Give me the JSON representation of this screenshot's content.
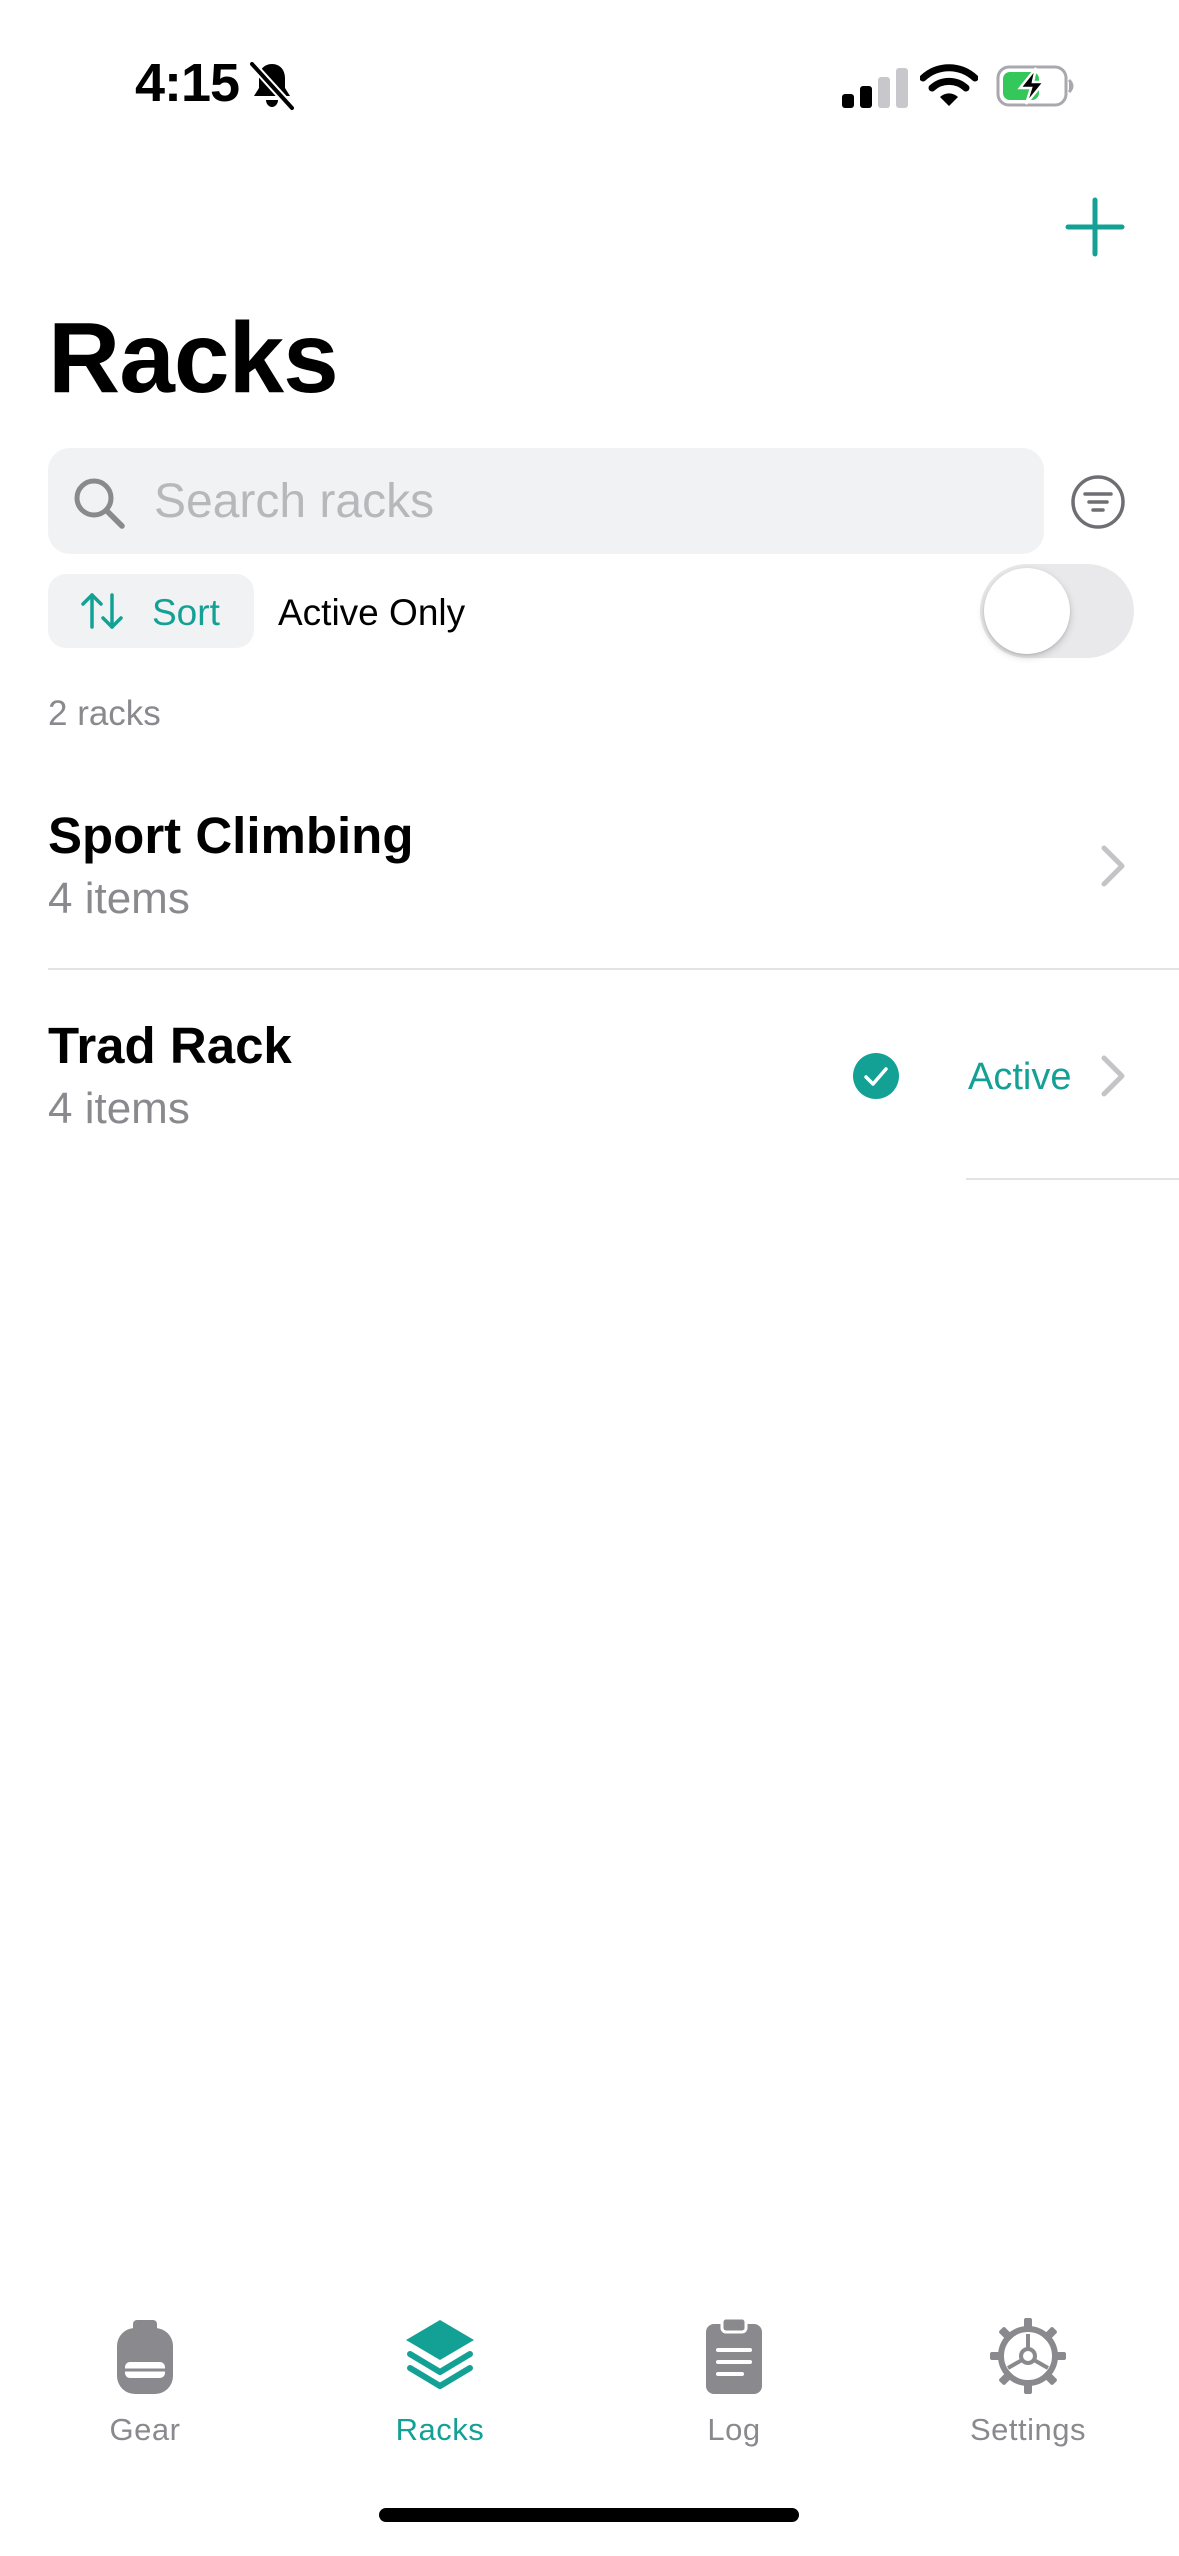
{
  "status_bar": {
    "time": "4:15",
    "silent_icon": "bell-slash-icon",
    "signal_icon": "cellular-signal-icon",
    "wifi_icon": "wifi-icon",
    "battery_icon": "battery-charging-icon"
  },
  "header": {
    "title": "Racks",
    "add_icon": "plus-icon"
  },
  "search": {
    "placeholder": "Search racks",
    "value": "",
    "filter_icon": "filter-icon"
  },
  "controls": {
    "sort_label": "Sort",
    "active_only_label": "Active Only",
    "active_only_on": false
  },
  "list": {
    "count_label": "2 racks",
    "racks": [
      {
        "name": "Sport Climbing",
        "items": "4 items",
        "active": false
      },
      {
        "name": "Trad Rack",
        "items": "4 items",
        "active": true,
        "active_label": "Active"
      }
    ]
  },
  "tab_bar": {
    "tabs": [
      {
        "label": "Gear",
        "icon": "backpack-icon",
        "selected": false
      },
      {
        "label": "Racks",
        "icon": "layers-icon",
        "selected": true
      },
      {
        "label": "Log",
        "icon": "clipboard-icon",
        "selected": false
      },
      {
        "label": "Settings",
        "icon": "gear-icon",
        "selected": false
      }
    ]
  },
  "colors": {
    "accent": "#14a195",
    "secondary_text": "#8a8a8e",
    "field_background": "#f1f2f4"
  }
}
